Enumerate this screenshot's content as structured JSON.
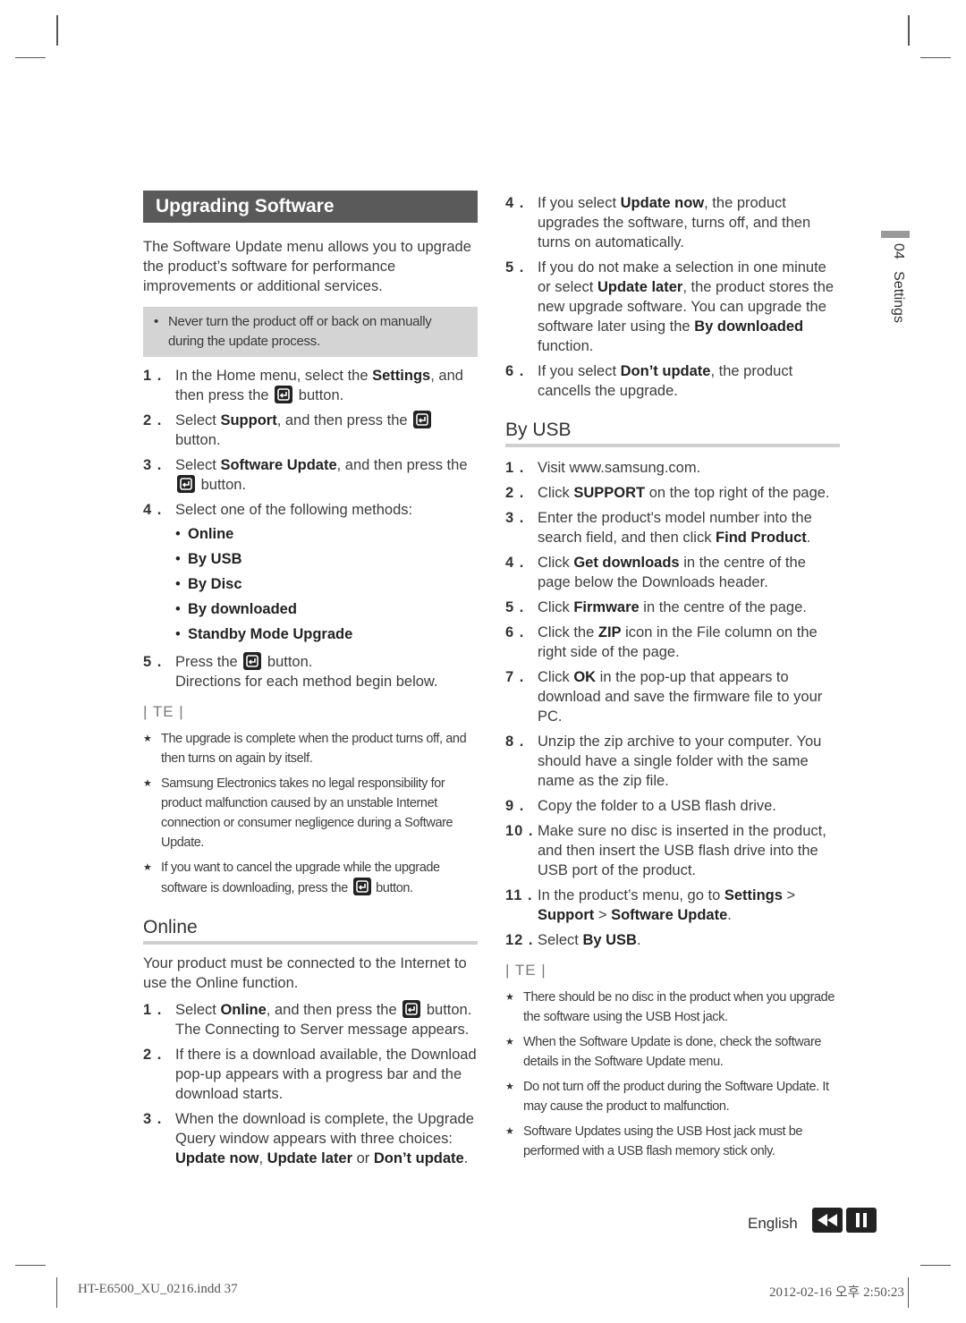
{
  "left": {
    "title": "Upgrading Software",
    "intro": "The Software Update menu allows you to upgrade the product’s software for performance improvements or additional services.",
    "caution": "Never turn the product off or back on manually during the update process.",
    "steps": [
      {
        "num": "1 .",
        "pre": "In the Home menu, select the ",
        "bold": "Settings",
        "post": ", and then press the",
        "post2": "button."
      },
      {
        "num": "2 .",
        "pre": "Select ",
        "bold": "Support",
        "post": ", and then press the",
        "post2": "button."
      },
      {
        "num": "3 .",
        "pre": "Select ",
        "bold": "Software Update",
        "post": ", and then press the",
        "post2": "button."
      },
      {
        "num": "4 .",
        "text": "Select one of the following methods:"
      },
      {
        "num": "5 .",
        "pre": "Press the",
        "post2": "button.",
        "line2": "Directions for each method begin below."
      }
    ],
    "methods": [
      "Online",
      "By USB",
      "By Disc",
      "By downloaded",
      "Standby Mode Upgrade"
    ],
    "note_label": "TE",
    "notes": [
      "The upgrade is complete when the product turns off, and then turns on again by itself.",
      "Samsung Electronics takes no legal responsibility for product malfunction caused by an unstable Internet connection or consumer negligence during a Software Update.",
      "If you want to cancel the upgrade while the upgrade software is downloading, press the"
    ],
    "note3_tail": "button.",
    "online": {
      "heading": "Online",
      "intro": "Your product must be connected to the Internet to use the Online function.",
      "step1": {
        "num": "1 .",
        "pre": "Select ",
        "bold": "Online",
        "post": ", and then press the",
        "post2": "button.",
        "line2": "The Connecting to Server message appears."
      },
      "step2": {
        "num": "2 .",
        "text": "If there is a download available, the Download pop-up appears with a progress bar and the download starts."
      },
      "step3": {
        "num": "3 .",
        "pre": "When the download is complete, the Upgrade Query window appears with three choices: ",
        "b1": "Update now",
        "m1": ", ",
        "b2": "Update later",
        "m2": " or ",
        "b3": "Don’t update",
        "post": "."
      }
    }
  },
  "right": {
    "online_cont": [
      {
        "num": "4 .",
        "pre": "If you select ",
        "bold": "Update now",
        "post": ", the product upgrades the software, turns off, and then turns on automatically."
      },
      {
        "num": "5 .",
        "pre": "If you do not make a selection in one minute or select ",
        "bold": "Update later",
        "post": ", the product stores the new upgrade software. You can upgrade the software later using the ",
        "bold2": "By downloaded",
        "post2": " function."
      },
      {
        "num": "6 .",
        "pre": "If you select ",
        "bold": "Don’t update",
        "post": ", the product cancells the upgrade."
      }
    ],
    "usb": {
      "heading": "By USB",
      "steps": [
        {
          "num": "1 .",
          "pre": "Visit www.samsung.com.",
          "bold": "",
          "post": ""
        },
        {
          "num": "2 .",
          "pre": "Click ",
          "bold": "SUPPORT",
          "post": " on the top right of the page."
        },
        {
          "num": "3 .",
          "pre": "Enter the product's model number into the search field, and then click ",
          "bold": "Find Product",
          "post": "."
        },
        {
          "num": "4 .",
          "pre": "Click ",
          "bold": "Get downloads",
          "post": " in the centre of the page below the Downloads header."
        },
        {
          "num": "5 .",
          "pre": "Click ",
          "bold": "Firmware",
          "post": " in the centre of the page."
        },
        {
          "num": "6 .",
          "pre": "Click the ",
          "bold": "ZIP",
          "post": " icon in the File column on the right side of the page."
        },
        {
          "num": "7 .",
          "pre": "Click ",
          "bold": "OK",
          "post": " in the pop-up that appears to download and save the firmware file to your PC."
        },
        {
          "num": "8 .",
          "pre": "Unzip the zip archive to your computer. You should have a single folder with the same name as the zip file.",
          "bold": "",
          "post": ""
        },
        {
          "num": "9 .",
          "pre": "Copy the folder to a USB flash drive.",
          "bold": "",
          "post": ""
        },
        {
          "num": "10 .",
          "pre": "Make sure no disc is inserted in the product, and then insert the USB flash drive into the USB port of the product.",
          "bold": "",
          "post": ""
        }
      ],
      "step11": {
        "num": "11 .",
        "pre": "In the product’s menu, go to ",
        "b1": "Settings",
        "m1": " > ",
        "b2": "Support",
        "m2": " > ",
        "b3": "Software Update",
        "post": "."
      },
      "step12": {
        "num": "12 .",
        "pre": "Select ",
        "bold": "By USB",
        "post": "."
      },
      "note_label": "TE",
      "notes": [
        "There should be no disc in the product when you upgrade the software using the USB Host jack.",
        "When the Software Update is done, check the software details in the Software Update menu.",
        "Do not turn off the product during the Software Update. It may cause the product to malfunction.",
        "Software Updates using the USB Host jack must be performed with a USB flash memory stick only."
      ]
    }
  },
  "side_tab": {
    "chapter": "04",
    "label": "Settings"
  },
  "footer": {
    "language": "English",
    "prev_icon": "rewind-icon",
    "pause_icon": "pause-icon",
    "slug_left": "HT-E6500_XU_0216.indd   37",
    "slug_right": "2012-02-16   오후 2:50:23"
  }
}
